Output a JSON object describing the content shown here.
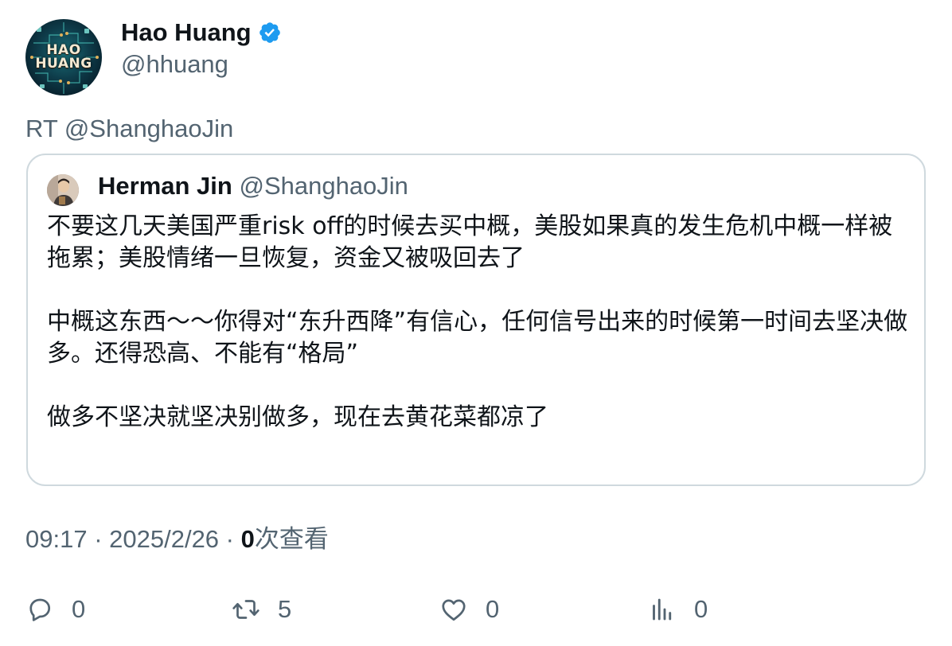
{
  "author": {
    "avatar_text_line1": "HAO",
    "avatar_text_line2": "HUANG",
    "name": "Hao Huang",
    "handle": "@hhuang",
    "verified_icon": "verified-badge-icon",
    "verified_color": "#1d9bf0"
  },
  "retweet": {
    "label": "RT @ShanghaoJin"
  },
  "quoted_tweet": {
    "name": "Herman Jin",
    "handle": "@ShanghaoJin",
    "paragraphs": [
      "不要这几天美国严重risk off的时候去买中概，美股如果真的发生危机中概一样被拖累；美股情绪一旦恢复，资金又被吸回去了",
      "中概这东西～～你得对“东升西降”有信心，任何信号出来的时候第一时间去坚决做多。还得恐高、不能有“格局”",
      "做多不坚决就坚决别做多，现在去黄花菜都凉了"
    ]
  },
  "meta": {
    "time": "09:17",
    "separator": " · ",
    "date": "2025/2/26",
    "views_count": "0",
    "views_label": "次查看"
  },
  "actions": {
    "reply": {
      "icon": "reply-icon",
      "count": "0"
    },
    "retweet": {
      "icon": "retweet-icon",
      "count": "5"
    },
    "like": {
      "icon": "heart-icon",
      "count": "0"
    },
    "views": {
      "icon": "analytics-icon",
      "count": "0"
    }
  },
  "colors": {
    "text_primary": "#0f1419",
    "text_secondary": "#536471",
    "border": "#cfd9de",
    "accent": "#1d9bf0"
  }
}
